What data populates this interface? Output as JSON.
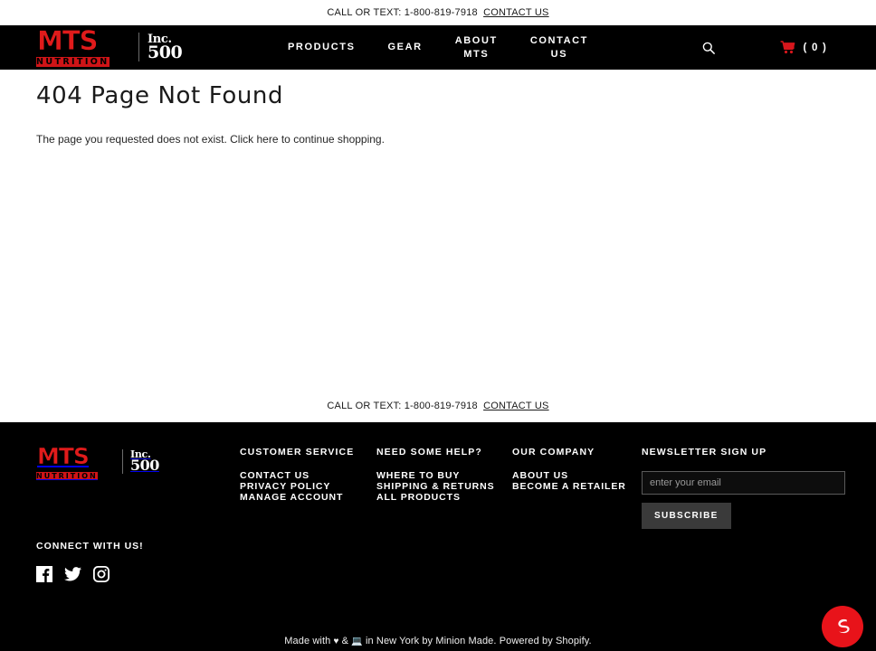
{
  "announcement": {
    "text": "CALL OR TEXT: 1-800-819-7918",
    "link_label": "CONTACT US"
  },
  "header": {
    "logo": {
      "mts": "MTS",
      "nutrition": "NUTRITION",
      "inc": "Inc.",
      "number": "500",
      "brand_red": "#cf1417"
    },
    "nav": [
      {
        "label": "PRODUCTS",
        "name": "nav-products"
      },
      {
        "label": "GEAR",
        "name": "nav-gear"
      },
      {
        "label": "ABOUT\nMTS",
        "name": "nav-about-mts"
      },
      {
        "label": "CONTACT\nUS",
        "name": "nav-contact-us"
      }
    ],
    "search_icon": "search-icon",
    "cart_icon": "shopping-cart-icon",
    "cart_count": "( 0 )"
  },
  "main": {
    "title": "404 Page Not Found",
    "body_before": "The page you requested does not exist. Click ",
    "body_link": "here",
    "body_after": " to continue shopping."
  },
  "footer": {
    "announcement": {
      "text": "CALL OR TEXT: 1-800-819-7918",
      "link_label": "CONTACT US"
    },
    "columns": [
      {
        "heading": "CUSTOMER SERVICE",
        "links": [
          "CONTACT US",
          "PRIVACY POLICY",
          "MANAGE ACCOUNT"
        ]
      },
      {
        "heading": "NEED SOME HELP?",
        "links": [
          "WHERE TO BUY",
          "SHIPPING & RETURNS",
          "ALL PRODUCTS"
        ]
      },
      {
        "heading": "OUR COMPANY",
        "links": [
          "ABOUT US",
          "BECOME A RETAILER"
        ]
      }
    ],
    "newsletter": {
      "heading": "NEWSLETTER SIGN UP",
      "placeholder": "enter your email",
      "value": "",
      "button": "SUBSCRIBE"
    },
    "connect": {
      "heading": "CONNECT WITH US!",
      "socials": [
        {
          "name": "facebook-icon",
          "label": "Facebook"
        },
        {
          "name": "twitter-icon",
          "label": "Twitter"
        },
        {
          "name": "instagram-icon",
          "label": "Instagram"
        }
      ]
    },
    "credit": {
      "prefix": "Made with ",
      "heart": "♥",
      "mid": " & ",
      "computer": "💻",
      "suffix": " in New York by ",
      "maker": "Minion Made",
      "powered_prefix": ". Powered by ",
      "powered": "Shopify",
      "period": "."
    }
  },
  "chat": {
    "name": "chat-widget-button",
    "color": "#e8131a"
  }
}
